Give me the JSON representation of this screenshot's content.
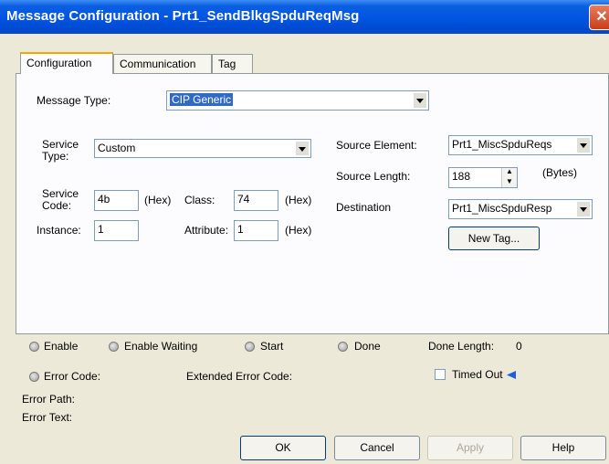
{
  "window": {
    "title": "Message Configuration - Prt1_SendBlkgSpduReqMsg",
    "close_glyph": "✕"
  },
  "tabs": [
    {
      "label": "Configuration"
    },
    {
      "label": "Communication"
    },
    {
      "label": "Tag"
    }
  ],
  "config": {
    "message_type_label": "Message Type:",
    "message_type_value": "CIP Generic",
    "service_type_label": "Service Type:",
    "service_type_value": "Custom",
    "service_code_label": "Service Code:",
    "service_code_value": "4b",
    "hex_label": "(Hex)",
    "class_label": "Class:",
    "class_value": "74",
    "instance_label": "Instance:",
    "instance_value": "1",
    "attribute_label": "Attribute:",
    "attribute_value": "1",
    "source_element_label": "Source Element:",
    "source_element_value": "Prt1_MiscSpduReqs",
    "source_length_label": "Source Length:",
    "source_length_value": "188",
    "bytes_label": "(Bytes)",
    "destination_label": "Destination",
    "destination_value": "Prt1_MiscSpduResp",
    "new_tag_label": "New Tag..."
  },
  "status": {
    "enable": "Enable",
    "enable_waiting": "Enable Waiting",
    "start": "Start",
    "done": "Done",
    "done_length_label": "Done Length:",
    "done_length_value": "0",
    "error_code": "Error Code:",
    "extended_error_code": "Extended Error Code:",
    "timed_out": "Timed Out",
    "error_path": "Error Path:",
    "error_text": "Error Text:"
  },
  "buttons": {
    "ok": "OK",
    "cancel": "Cancel",
    "apply": "Apply",
    "help": "Help"
  },
  "colors": {
    "title_bar": "#0054e3",
    "selection": "#316ac5",
    "dialog_bg": "#ece9d8"
  }
}
